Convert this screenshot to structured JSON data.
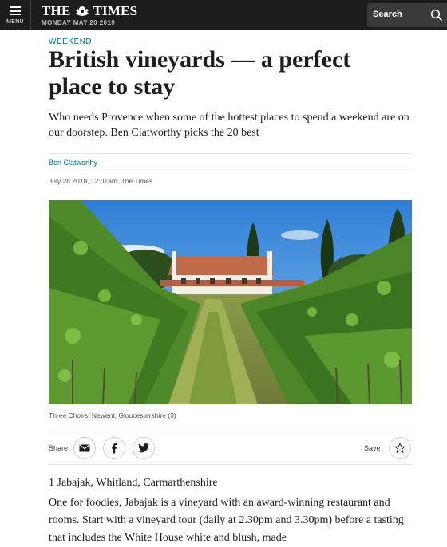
{
  "header": {
    "menu_label": "MENU",
    "masthead_left": "THE",
    "masthead_right": "TIMES",
    "date": "MONDAY MAY 20 2019",
    "search_label": "Search"
  },
  "article": {
    "section": "WEEKEND",
    "headline": "British vineyards — a perfect place to stay",
    "standfirst": "Who needs Provence when some of the hottest places to spend a weekend are on our doorstep. Ben Clatworthy picks the 20 best",
    "author": "Ben Clatworthy",
    "published": "July 28 2018, 12:01am, The Times",
    "image_caption": "Three Choirs, Newent, Gloucestershire (3)"
  },
  "share_bar": {
    "share_label": "Share",
    "save_label": "Save"
  },
  "entry": {
    "title": "1 Jabajak, Whitland, Carmarthenshire",
    "body": "One for foodies, Jabajak is a vineyard with an award-winning restaurant and rooms. Start with a vineyard tour (daily at 2.30pm and 3.30pm) before a tasting that includes the White House white and blush, made"
  },
  "colors": {
    "topbar": "#1d1d1b",
    "accent": "#00718a",
    "search_box": "#3a3a3a"
  },
  "icons": [
    "menu-icon",
    "times-crest-icon",
    "search-icon",
    "email-icon",
    "facebook-icon",
    "twitter-icon",
    "bookmark-star-icon"
  ]
}
